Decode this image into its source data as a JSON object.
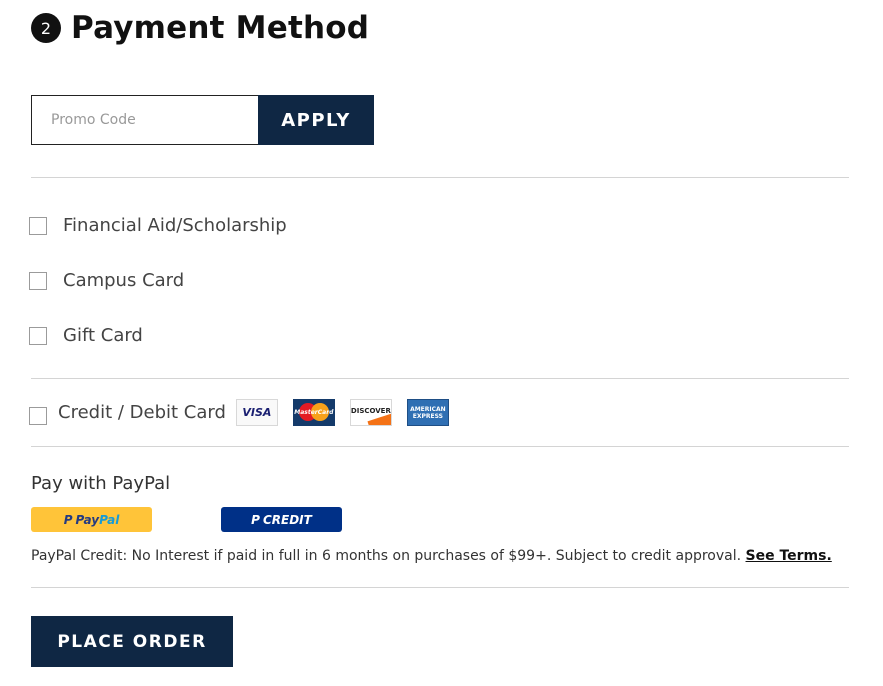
{
  "header": {
    "step_number": "2",
    "title": "Payment Method"
  },
  "promo": {
    "placeholder": "Promo Code",
    "value": "",
    "apply_label": "APPLY"
  },
  "payment_options": [
    {
      "label": "Financial Aid/Scholarship",
      "checked": false
    },
    {
      "label": "Campus Card",
      "checked": false
    },
    {
      "label": "Gift Card",
      "checked": false
    }
  ],
  "credit_card": {
    "label": "Credit / Debit Card",
    "checked": false,
    "logos": [
      {
        "name": "visa-logo",
        "text": "VISA"
      },
      {
        "name": "mastercard-logo",
        "text": "MasterCard"
      },
      {
        "name": "discover-logo",
        "text": "DISCOVER"
      },
      {
        "name": "amex-logo",
        "text_lines": [
          "AMERICAN",
          "EXPRESS"
        ]
      }
    ]
  },
  "paypal": {
    "heading": "Pay with PayPal",
    "paypal_button": {
      "pay": "Pay",
      "pal": "Pal",
      "glyph": "P"
    },
    "credit_button": {
      "label": "CREDIT",
      "glyph": "P"
    },
    "credit_note": "PayPal Credit: No Interest if paid in full in 6 months on purchases of $99+. Subject to credit approval.",
    "terms_link": "See Terms."
  },
  "actions": {
    "place_order": "PLACE ORDER"
  },
  "colors": {
    "primary_navy": "#0f2744",
    "paypal_gold": "#ffc439",
    "paypal_credit_blue": "#003087",
    "divider": "#d4d4d4"
  }
}
